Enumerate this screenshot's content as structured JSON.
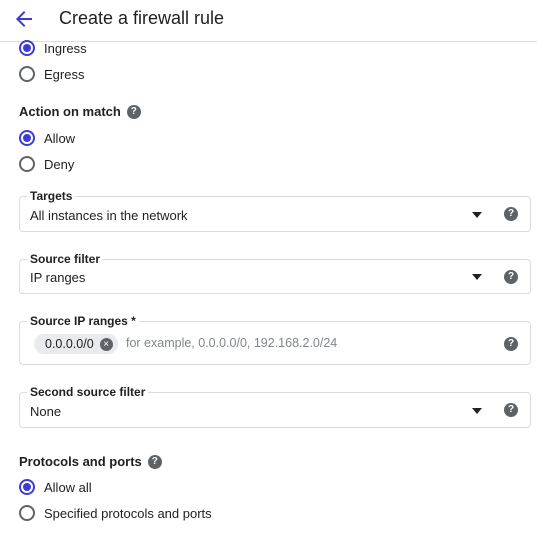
{
  "header": {
    "title": "Create a firewall rule"
  },
  "direction": {
    "options": [
      {
        "label": "Ingress",
        "selected": true
      },
      {
        "label": "Egress",
        "selected": false
      }
    ]
  },
  "action_on_match": {
    "title": "Action on match",
    "options": [
      {
        "label": "Allow",
        "selected": true
      },
      {
        "label": "Deny",
        "selected": false
      }
    ]
  },
  "targets": {
    "label": "Targets",
    "value": "All instances in the network"
  },
  "source_filter": {
    "label": "Source filter",
    "value": "IP ranges"
  },
  "source_ip_ranges": {
    "label": "Source IP ranges *",
    "chip": "0.0.0.0/0",
    "placeholder": "for example, 0.0.0.0/0, 192.168.2.0/24"
  },
  "second_source_filter": {
    "label": "Second source filter",
    "value": "None"
  },
  "protocols_and_ports": {
    "title": "Protocols and ports",
    "options": [
      {
        "label": "Allow all",
        "selected": true
      },
      {
        "label": "Specified protocols and ports",
        "selected": false
      }
    ]
  },
  "help_glyph": "?",
  "chip_remove_glyph": "×",
  "colors": {
    "accent": "#3c3cd4",
    "border": "#dadce0",
    "icon": "#5f6368"
  }
}
